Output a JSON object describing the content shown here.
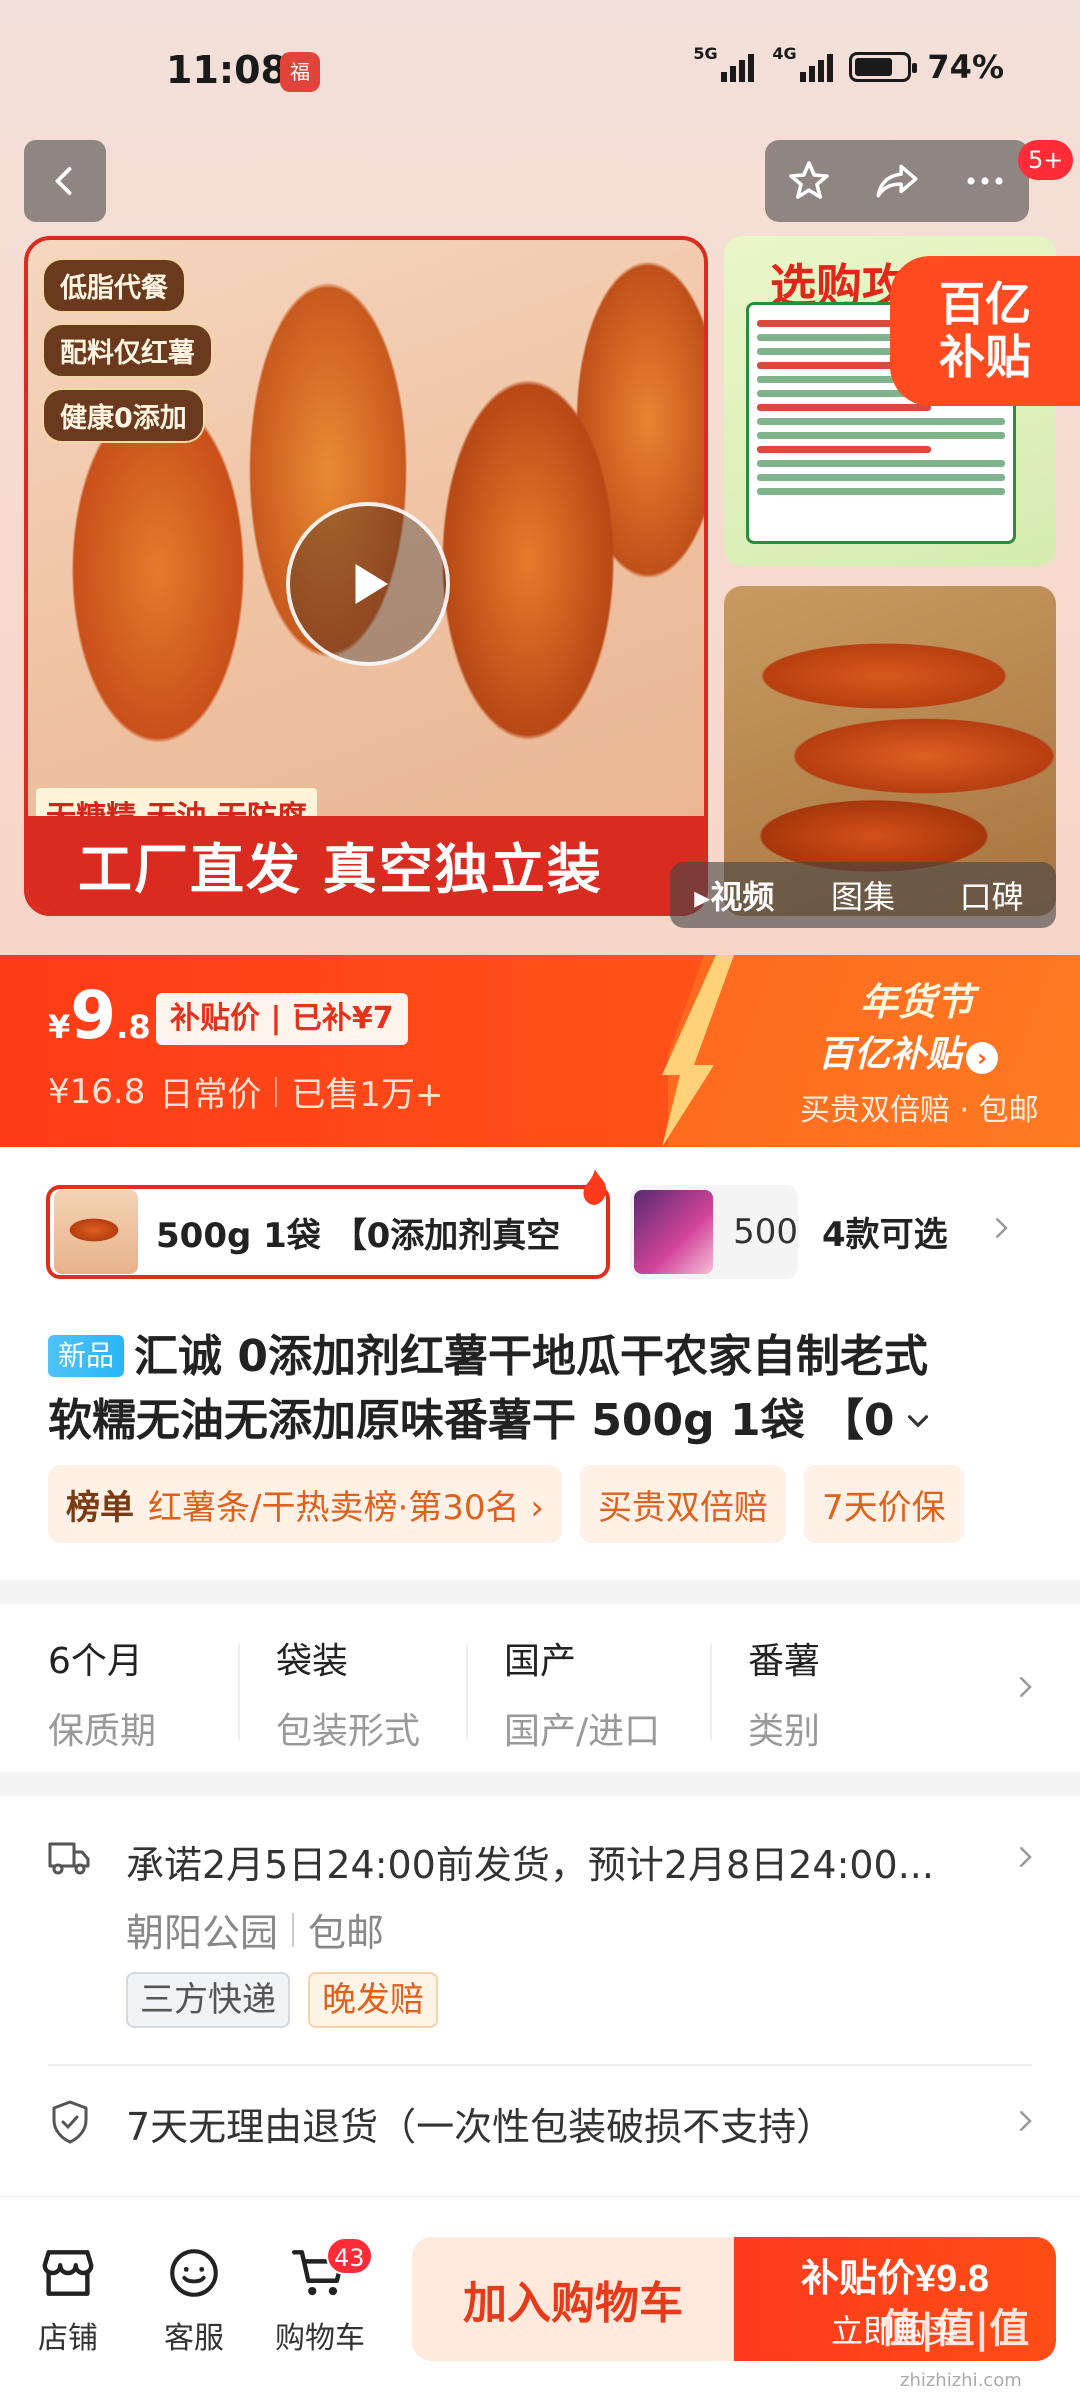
{
  "status_bar": {
    "time": "11:08",
    "app_icon": "福",
    "net1": "5G",
    "net2": "4G",
    "battery": "74%"
  },
  "nav": {
    "badge": "5+"
  },
  "gallery": {
    "main_tags": [
      "低脂代餐",
      "配料仅红薯",
      "健康0添加"
    ],
    "main_subline": "无糖精 无油 无防腐",
    "main_band": "工厂直发  真空独立装",
    "side1_heading": "选购攻",
    "badge_line1": "百亿",
    "badge_line2": "补贴",
    "media_tabs": [
      "视频",
      "图集",
      "口碑"
    ]
  },
  "price": {
    "yen": "¥",
    "int": "9",
    "dec": ".8",
    "subsidy_tag": "补贴价 | 已补¥7",
    "original": "¥16.8",
    "original_label": "日常价",
    "sold": "已售1万+",
    "festival": "年货节",
    "platform": "百亿补贴",
    "banner_sub": "买贵双倍赔 · 包邮"
  },
  "sku": {
    "selected": "500g 1袋 【0添加剂真空",
    "second": "500",
    "count": "4款可选"
  },
  "title": {
    "new_tag": "新品",
    "line1": "汇诚 0添加剂红薯干地瓜干农家自制老式",
    "line2": "软糯无油无添加原味番薯干 500g 1袋 【0"
  },
  "rank": {
    "label": "榜单",
    "text": "红薯条/干热卖榜·第30名 ›",
    "chip2": "买贵双倍赔",
    "chip3": "7天价保"
  },
  "attributes": [
    {
      "value": "6个月",
      "key": "保质期"
    },
    {
      "value": "袋装",
      "key": "包装形式"
    },
    {
      "value": "国产",
      "key": "国产/进口"
    },
    {
      "value": "番薯",
      "key": "类别"
    }
  ],
  "shipping": {
    "text": "承诺2月5日24:00前发货，预计2月8日24:00...",
    "location": "朝阳公园",
    "free": "包邮",
    "tag1": "三方快递",
    "tag2": "晚发赔"
  },
  "service": {
    "text": "7天无理由退货（一次性包装破损不支持）"
  },
  "bottom": {
    "shop": "店铺",
    "service": "客服",
    "cart": "购物车",
    "cart_count": "43",
    "add_cart": "加入购物车",
    "buy_price": "补贴价¥9.8",
    "buy_now": "立即购买"
  },
  "watermark": {
    "logo": "值|值|值",
    "url": "zhizhizhi.com"
  },
  "colors": {
    "accent": "#ff3b17",
    "subsidy_red": "#e32c1c",
    "tag_orange": "#e0601c"
  }
}
